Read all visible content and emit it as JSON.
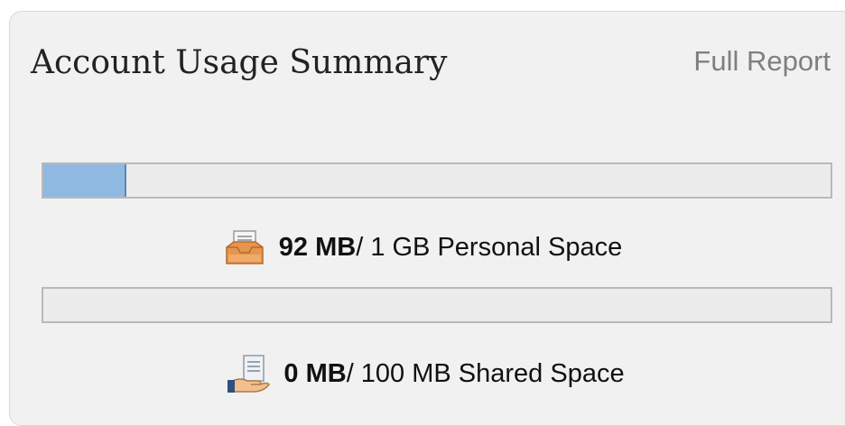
{
  "panel": {
    "title": "Account Usage Summary",
    "full_report_label": "Full Report"
  },
  "personal": {
    "icon": "inbox-tray-icon",
    "used": "92 MB",
    "rest": " / 1 GB Personal Space",
    "used_fraction": 0.105
  },
  "shared": {
    "icon": "shared-documents-icon",
    "used": "0 MB",
    "rest": " / 100 MB Shared Space",
    "used_fraction": 0
  },
  "colors": {
    "bar_fill": "#8fb9e0",
    "bar_track": "#ececec",
    "panel_background": "#f2f1f1"
  }
}
